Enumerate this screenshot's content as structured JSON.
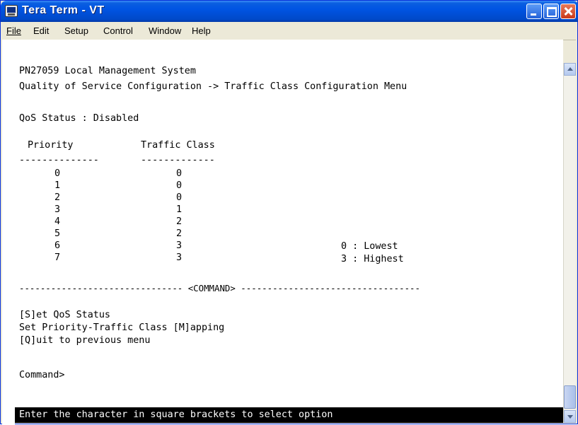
{
  "window": {
    "title": "Tera Term - VT"
  },
  "menu": [
    "File",
    "Edit",
    "Setup",
    "Control",
    "Window",
    "Help"
  ],
  "terminal": {
    "system_name": "PN27059 Local Management System",
    "breadcrumb": "Quality of Service Configuration -> Traffic Class Configuration Menu",
    "qos_status": "QoS Status : Disabled",
    "table_header_priority": "Priority",
    "table_header_traffic_class": "Traffic Class",
    "underline_priority": "--------------",
    "underline_traffic_class": "-------------",
    "rows": [
      {
        "priority": "0",
        "traffic_class": "0"
      },
      {
        "priority": "1",
        "traffic_class": "0"
      },
      {
        "priority": "2",
        "traffic_class": "0"
      },
      {
        "priority": "3",
        "traffic_class": "1"
      },
      {
        "priority": "4",
        "traffic_class": "2"
      },
      {
        "priority": "5",
        "traffic_class": "2"
      },
      {
        "priority": "6",
        "traffic_class": "3"
      },
      {
        "priority": "7",
        "traffic_class": "3"
      }
    ],
    "legend_lowest": "0 : Lowest",
    "legend_highest": "3 : Highest",
    "command_separator": "------------------------------- <COMMAND> ----------------------------------",
    "options": [
      "[S]et QoS Status",
      "Set Priority-Traffic Class [M]apping",
      "[Q]uit to previous menu"
    ],
    "prompt": "Command>",
    "status_line": "Enter the character in square brackets to select option"
  }
}
